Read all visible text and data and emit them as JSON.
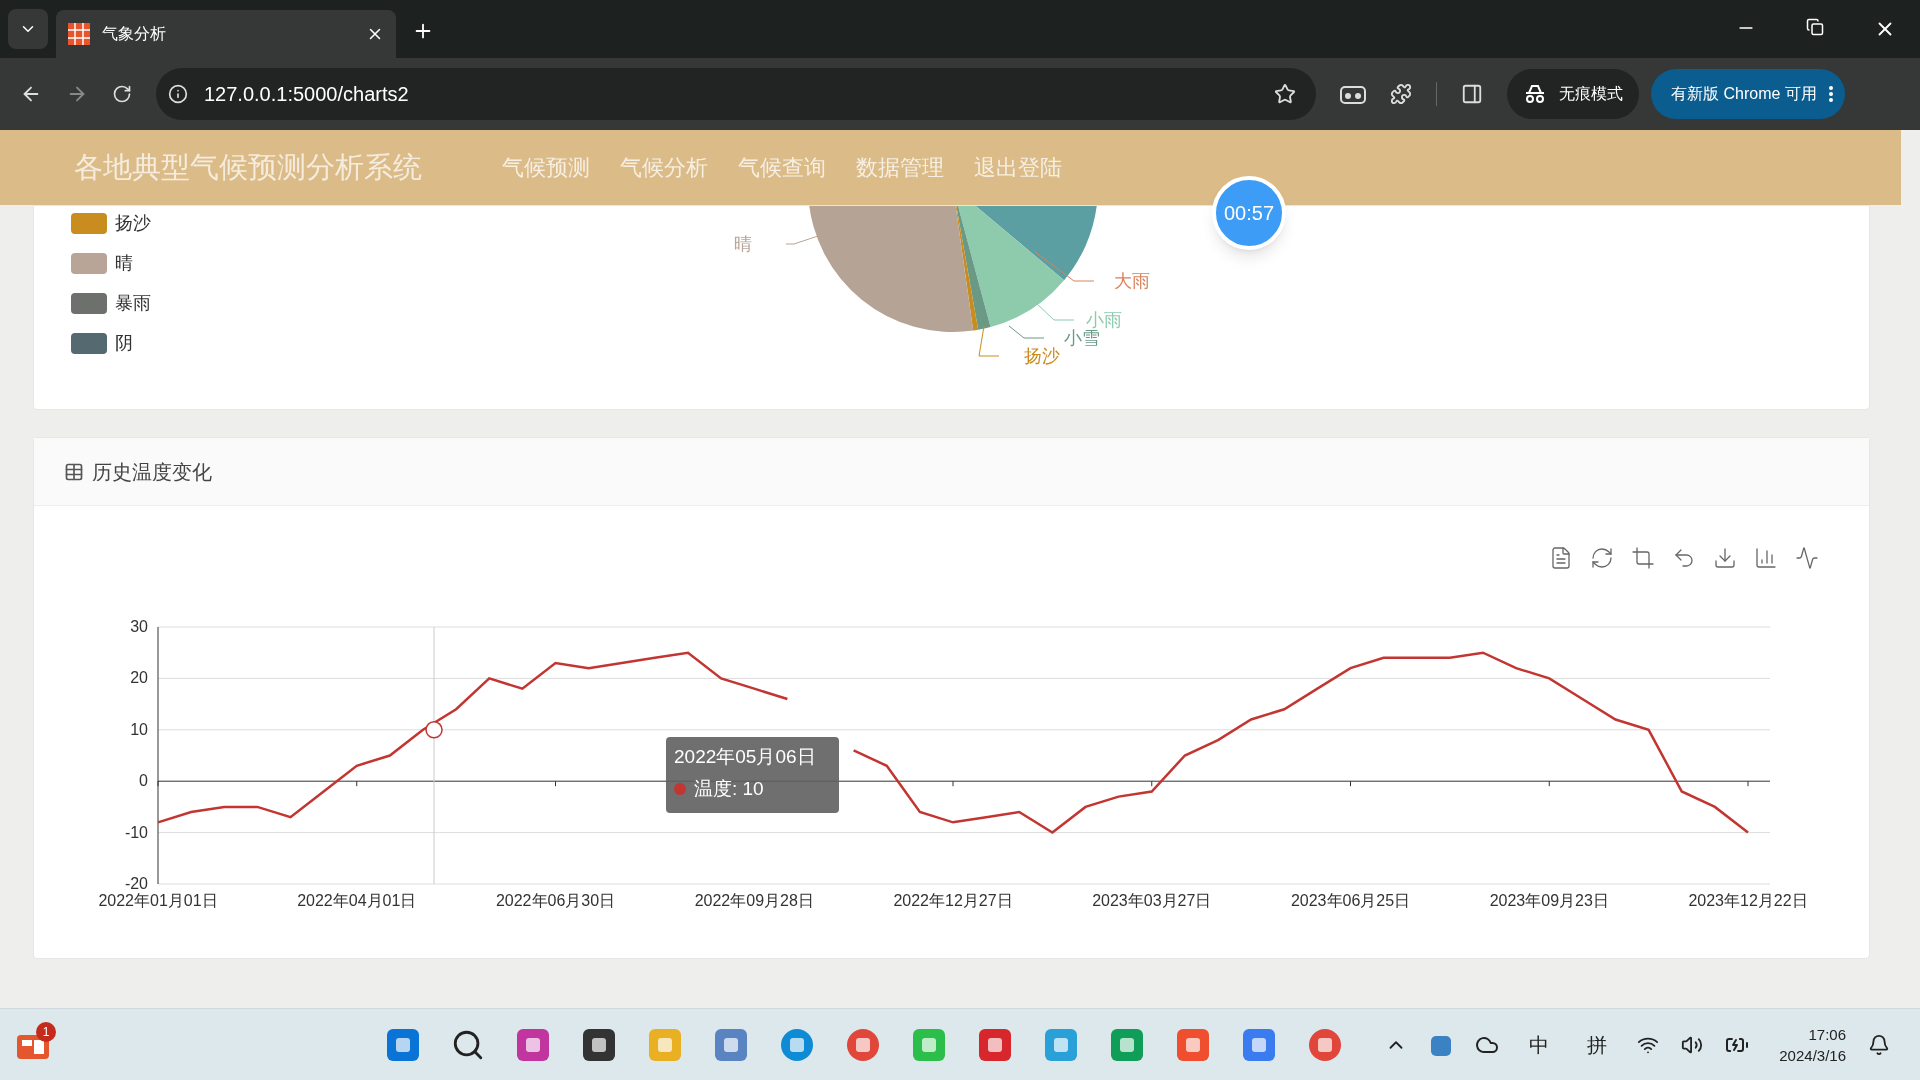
{
  "browser": {
    "tab_title": "气象分析",
    "url": "127.0.0.1:5000/charts2",
    "incognito_label": "无痕模式",
    "update_button": "有新版 Chrome 可用"
  },
  "header": {
    "title": "各地典型气候预测分析系统",
    "nav": [
      "气候预测",
      "气候分析",
      "气候查询",
      "数据管理",
      "退出登陆"
    ]
  },
  "timer": "00:57",
  "weather_card": {
    "legend": [
      {
        "label": "扬沙",
        "color": "#c98c1f"
      },
      {
        "label": "晴",
        "color": "#b8a598"
      },
      {
        "label": "暴雨",
        "color": "#6d706c"
      },
      {
        "label": "阴",
        "color": "#546a70"
      }
    ],
    "pie_labels": [
      {
        "label": "晴",
        "color": "#b8a598"
      },
      {
        "label": "大雨",
        "color": "#d9825b"
      },
      {
        "label": "小雨",
        "color": "#8ecbad"
      },
      {
        "label": "小雪",
        "color": "#6a9a86"
      },
      {
        "label": "扬沙",
        "color": "#c98c1f"
      }
    ]
  },
  "temperature_card": {
    "title": "历史温度变化",
    "chart_data": {
      "type": "line",
      "categories": [
        "2022年01月01日",
        null,
        null,
        null,
        null,
        null,
        "2022年04月01日",
        null,
        null,
        null,
        null,
        null,
        "2022年06月30日",
        null,
        null,
        null,
        null,
        null,
        "2022年09月28日",
        null,
        null,
        null,
        null,
        null,
        "2022年12月27日",
        null,
        null,
        null,
        null,
        null,
        "2023年03月27日",
        null,
        null,
        null,
        null,
        null,
        "2023年06月25日",
        null,
        null,
        null,
        null,
        null,
        "2023年09月23日",
        null,
        null,
        null,
        null,
        null,
        "2023年12月22日"
      ],
      "series": [
        {
          "color": "#c23531",
          "values": [
            -8,
            -6,
            -5,
            -5,
            -7,
            -2,
            3,
            5,
            10,
            14,
            20,
            18,
            23,
            22,
            23,
            24,
            25,
            20,
            18,
            16,
            null,
            6,
            3,
            -6,
            -8,
            -7,
            -6,
            -10,
            -5,
            -3,
            -2,
            5,
            8,
            12,
            14,
            18,
            22,
            24,
            24,
            24,
            25,
            22,
            20,
            16,
            12,
            10,
            -2,
            -5,
            -10
          ]
        }
      ],
      "ylim": [
        -20,
        30
      ],
      "grid": true,
      "yticks": [
        -20,
        -10,
        0,
        10,
        20,
        30
      ]
    },
    "tooltip": {
      "date": "2022年05月06日",
      "text": "温度: 10"
    }
  },
  "taskbar": {
    "badge": "1",
    "input_method": [
      "中",
      "拼"
    ],
    "time": "17:06",
    "date": "2024/3/16"
  }
}
